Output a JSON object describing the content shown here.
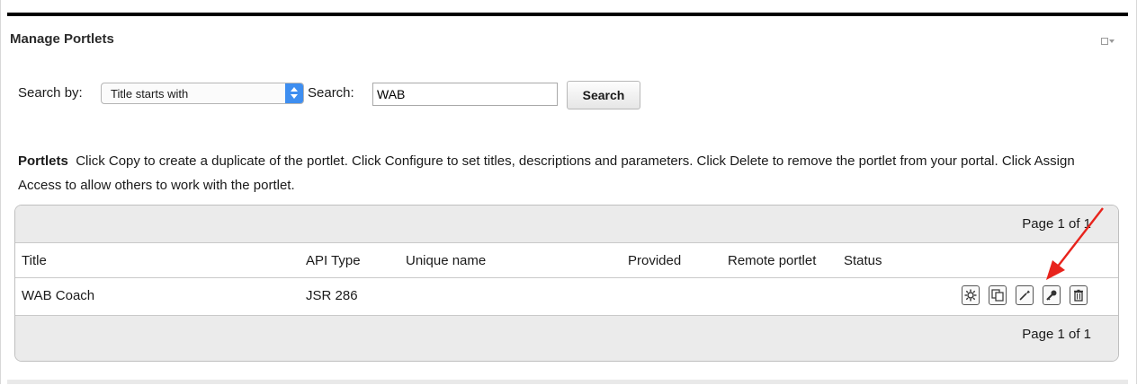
{
  "portlet": {
    "title": "Manage Portlets",
    "menu_icon": "portlet-menu-icon"
  },
  "search": {
    "search_by_label": "Search by:",
    "search_by_selected": "Title starts with",
    "search_label": "Search:",
    "search_value": "WAB",
    "search_button_label": "Search"
  },
  "description": {
    "heading": "Portlets",
    "text": "Click Copy to create a duplicate of the portlet. Click Configure to set titles, descriptions and parameters. Click Delete to remove the portlet from your portal. Click Assign Access to allow others to work with the portlet."
  },
  "table": {
    "pager_top": "Page 1 of 1",
    "pager_bottom": "Page 1 of 1",
    "columns": [
      "Title",
      "API Type",
      "Unique name",
      "Provided",
      "Remote portlet",
      "Status"
    ],
    "rows": [
      {
        "title": "WAB Coach",
        "api_type": "JSR 286",
        "unique_name": "",
        "provided": "",
        "remote_portlet": "",
        "status": "",
        "actions": [
          "settings-icon",
          "copy-icon",
          "configure-wrench-icon",
          "assign-access-key-icon",
          "delete-trash-icon"
        ]
      }
    ]
  },
  "colors": {
    "annotation_arrow": "#e8231c",
    "select_button": "#3e8ef0",
    "pager_bg": "#ebebeb"
  }
}
